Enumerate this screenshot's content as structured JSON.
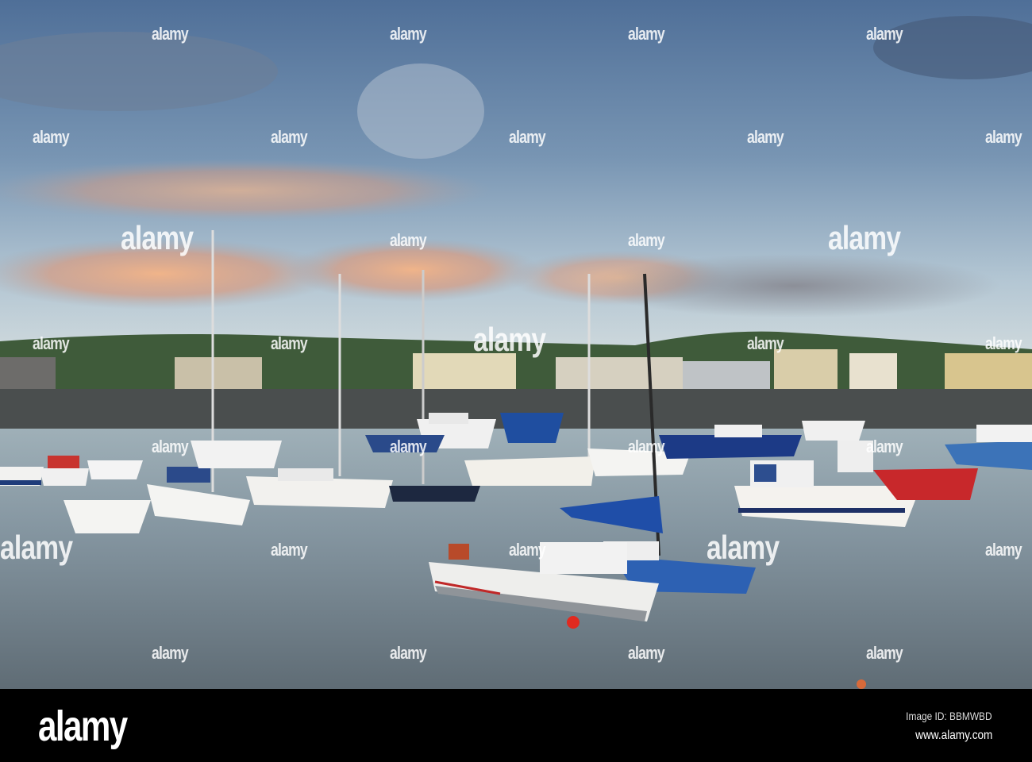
{
  "watermark": {
    "text": "alamy"
  },
  "footer": {
    "logo": "alamy",
    "image_id": "Image ID: BBMWBD",
    "url": "www.alamy.com"
  },
  "colors": {
    "sky_top": "#4f6f98",
    "sky_horizon": "#c5d3dc",
    "cloud_glow": "#e8a77c",
    "hill": "#3e5a38",
    "water": "#7d8d97",
    "bar": "#000000"
  }
}
